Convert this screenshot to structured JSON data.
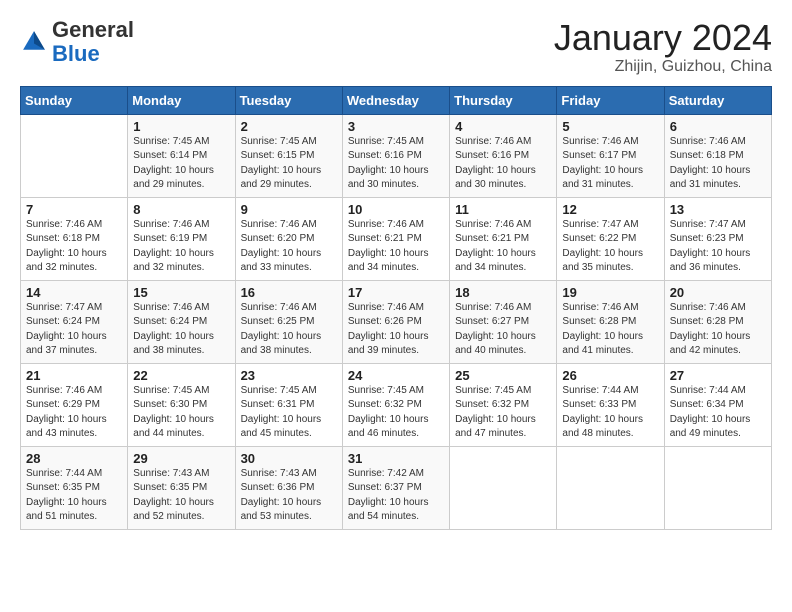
{
  "header": {
    "logo": {
      "general": "General",
      "blue": "Blue"
    },
    "title": "January 2024",
    "location": "Zhijin, Guizhou, China"
  },
  "weekdays": [
    "Sunday",
    "Monday",
    "Tuesday",
    "Wednesday",
    "Thursday",
    "Friday",
    "Saturday"
  ],
  "weeks": [
    [
      {
        "day": "",
        "info": ""
      },
      {
        "day": "1",
        "info": "Sunrise: 7:45 AM\nSunset: 6:14 PM\nDaylight: 10 hours\nand 29 minutes."
      },
      {
        "day": "2",
        "info": "Sunrise: 7:45 AM\nSunset: 6:15 PM\nDaylight: 10 hours\nand 29 minutes."
      },
      {
        "day": "3",
        "info": "Sunrise: 7:45 AM\nSunset: 6:16 PM\nDaylight: 10 hours\nand 30 minutes."
      },
      {
        "day": "4",
        "info": "Sunrise: 7:46 AM\nSunset: 6:16 PM\nDaylight: 10 hours\nand 30 minutes."
      },
      {
        "day": "5",
        "info": "Sunrise: 7:46 AM\nSunset: 6:17 PM\nDaylight: 10 hours\nand 31 minutes."
      },
      {
        "day": "6",
        "info": "Sunrise: 7:46 AM\nSunset: 6:18 PM\nDaylight: 10 hours\nand 31 minutes."
      }
    ],
    [
      {
        "day": "7",
        "info": "Sunrise: 7:46 AM\nSunset: 6:18 PM\nDaylight: 10 hours\nand 32 minutes."
      },
      {
        "day": "8",
        "info": "Sunrise: 7:46 AM\nSunset: 6:19 PM\nDaylight: 10 hours\nand 32 minutes."
      },
      {
        "day": "9",
        "info": "Sunrise: 7:46 AM\nSunset: 6:20 PM\nDaylight: 10 hours\nand 33 minutes."
      },
      {
        "day": "10",
        "info": "Sunrise: 7:46 AM\nSunset: 6:21 PM\nDaylight: 10 hours\nand 34 minutes."
      },
      {
        "day": "11",
        "info": "Sunrise: 7:46 AM\nSunset: 6:21 PM\nDaylight: 10 hours\nand 34 minutes."
      },
      {
        "day": "12",
        "info": "Sunrise: 7:47 AM\nSunset: 6:22 PM\nDaylight: 10 hours\nand 35 minutes."
      },
      {
        "day": "13",
        "info": "Sunrise: 7:47 AM\nSunset: 6:23 PM\nDaylight: 10 hours\nand 36 minutes."
      }
    ],
    [
      {
        "day": "14",
        "info": "Sunrise: 7:47 AM\nSunset: 6:24 PM\nDaylight: 10 hours\nand 37 minutes."
      },
      {
        "day": "15",
        "info": "Sunrise: 7:46 AM\nSunset: 6:24 PM\nDaylight: 10 hours\nand 38 minutes."
      },
      {
        "day": "16",
        "info": "Sunrise: 7:46 AM\nSunset: 6:25 PM\nDaylight: 10 hours\nand 38 minutes."
      },
      {
        "day": "17",
        "info": "Sunrise: 7:46 AM\nSunset: 6:26 PM\nDaylight: 10 hours\nand 39 minutes."
      },
      {
        "day": "18",
        "info": "Sunrise: 7:46 AM\nSunset: 6:27 PM\nDaylight: 10 hours\nand 40 minutes."
      },
      {
        "day": "19",
        "info": "Sunrise: 7:46 AM\nSunset: 6:28 PM\nDaylight: 10 hours\nand 41 minutes."
      },
      {
        "day": "20",
        "info": "Sunrise: 7:46 AM\nSunset: 6:28 PM\nDaylight: 10 hours\nand 42 minutes."
      }
    ],
    [
      {
        "day": "21",
        "info": "Sunrise: 7:46 AM\nSunset: 6:29 PM\nDaylight: 10 hours\nand 43 minutes."
      },
      {
        "day": "22",
        "info": "Sunrise: 7:45 AM\nSunset: 6:30 PM\nDaylight: 10 hours\nand 44 minutes."
      },
      {
        "day": "23",
        "info": "Sunrise: 7:45 AM\nSunset: 6:31 PM\nDaylight: 10 hours\nand 45 minutes."
      },
      {
        "day": "24",
        "info": "Sunrise: 7:45 AM\nSunset: 6:32 PM\nDaylight: 10 hours\nand 46 minutes."
      },
      {
        "day": "25",
        "info": "Sunrise: 7:45 AM\nSunset: 6:32 PM\nDaylight: 10 hours\nand 47 minutes."
      },
      {
        "day": "26",
        "info": "Sunrise: 7:44 AM\nSunset: 6:33 PM\nDaylight: 10 hours\nand 48 minutes."
      },
      {
        "day": "27",
        "info": "Sunrise: 7:44 AM\nSunset: 6:34 PM\nDaylight: 10 hours\nand 49 minutes."
      }
    ],
    [
      {
        "day": "28",
        "info": "Sunrise: 7:44 AM\nSunset: 6:35 PM\nDaylight: 10 hours\nand 51 minutes."
      },
      {
        "day": "29",
        "info": "Sunrise: 7:43 AM\nSunset: 6:35 PM\nDaylight: 10 hours\nand 52 minutes."
      },
      {
        "day": "30",
        "info": "Sunrise: 7:43 AM\nSunset: 6:36 PM\nDaylight: 10 hours\nand 53 minutes."
      },
      {
        "day": "31",
        "info": "Sunrise: 7:42 AM\nSunset: 6:37 PM\nDaylight: 10 hours\nand 54 minutes."
      },
      {
        "day": "",
        "info": ""
      },
      {
        "day": "",
        "info": ""
      },
      {
        "day": "",
        "info": ""
      }
    ]
  ]
}
